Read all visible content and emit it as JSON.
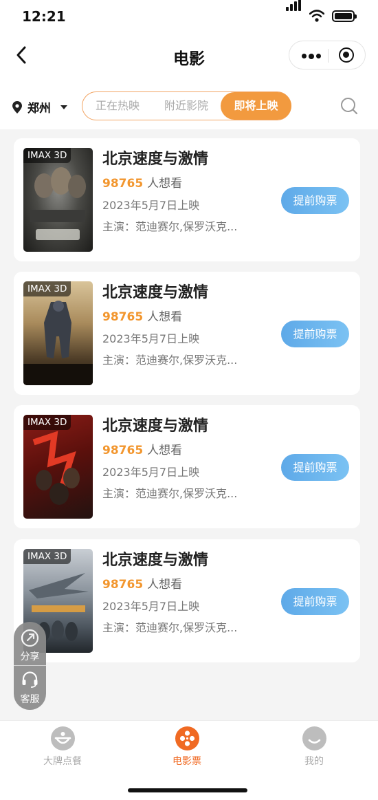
{
  "status_bar": {
    "time": "12:21"
  },
  "navbar": {
    "title": "电影"
  },
  "filter": {
    "city": "郑州",
    "tabs": [
      {
        "label": "正在热映",
        "active": false
      },
      {
        "label": "附近影院",
        "active": false
      },
      {
        "label": "即将上映",
        "active": true
      }
    ]
  },
  "movies": [
    {
      "tag": "IMAX 3D",
      "name": "北京速度与激情",
      "want_count": "98765",
      "want_label": "人想看",
      "release": "2023年5月7日上映",
      "stars": "主演：范迪赛尔,保罗沃克...",
      "buy_label": "提前购票"
    },
    {
      "tag": "IMAX 3D",
      "name": "北京速度与激情",
      "want_count": "98765",
      "want_label": "人想看",
      "release": "2023年5月7日上映",
      "stars": "主演：范迪赛尔,保罗沃克...",
      "buy_label": "提前购票"
    },
    {
      "tag": "IMAX 3D",
      "name": "北京速度与激情",
      "want_count": "98765",
      "want_label": "人想看",
      "release": "2023年5月7日上映",
      "stars": "主演：范迪赛尔,保罗沃克...",
      "buy_label": "提前购票"
    },
    {
      "tag": "IMAX 3D",
      "name": "北京速度与激情",
      "want_count": "98765",
      "want_label": "人想看",
      "release": "2023年5月7日上映",
      "stars": "主演：范迪赛尔,保罗沃克...",
      "buy_label": "提前购票"
    }
  ],
  "float_actions": [
    {
      "label": "分享",
      "icon": "share-icon"
    },
    {
      "label": "客服",
      "icon": "headset-icon"
    }
  ],
  "tabbar": {
    "items": [
      {
        "label": "大牌点餐",
        "icon": "food-icon",
        "active": false
      },
      {
        "label": "电影票",
        "icon": "film-reel-icon",
        "active": true
      },
      {
        "label": "我的",
        "icon": "profile-icon",
        "active": false
      }
    ]
  },
  "colors": {
    "accent_orange": "#f29a3f",
    "buy_blue": "#6bb5ee",
    "tab_active": "#f06a23"
  }
}
